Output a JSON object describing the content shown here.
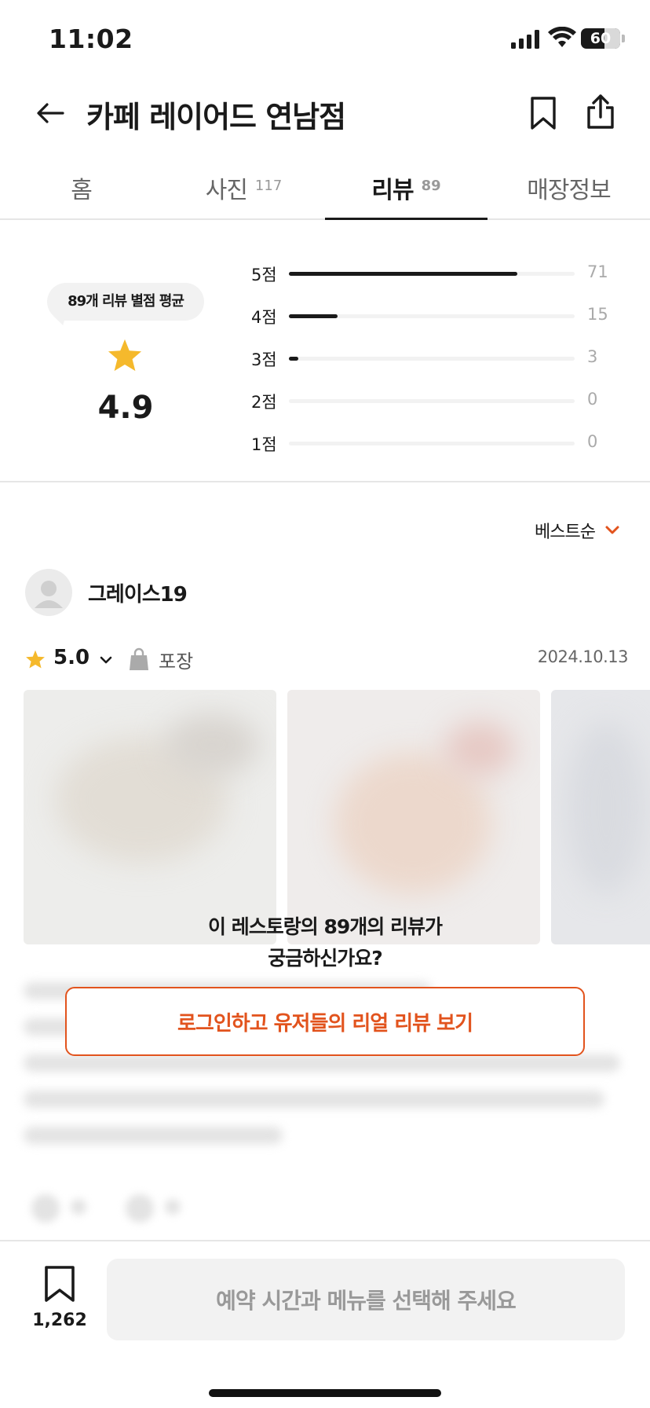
{
  "status_bar": {
    "time": "11:02",
    "battery": "60",
    "battery_fraction": 0.6
  },
  "header": {
    "title": "카페 레이어드 연남점"
  },
  "tabs": [
    {
      "label": "홈",
      "count": ""
    },
    {
      "label": "사진",
      "count": "117"
    },
    {
      "label": "리뷰",
      "count": "89"
    },
    {
      "label": "매장정보",
      "count": ""
    }
  ],
  "active_tab": "리뷰",
  "rating_summary": {
    "bubble_label": "89개 리뷰 별점 평균",
    "average": "4.9",
    "distribution": [
      {
        "label": "5점",
        "count": "71",
        "fraction": 0.8
      },
      {
        "label": "4점",
        "count": "15",
        "fraction": 0.17
      },
      {
        "label": "3점",
        "count": "3",
        "fraction": 0.03
      },
      {
        "label": "2점",
        "count": "0",
        "fraction": 0
      },
      {
        "label": "1점",
        "count": "0",
        "fraction": 0
      }
    ]
  },
  "sort": {
    "label": "베스트순"
  },
  "review": {
    "author": "그레이스19",
    "rating": "5.0",
    "type": "포장",
    "date": "2024.10.13"
  },
  "login_gate": {
    "question_line1": "이 레스토랑의 89개의 리뷰가",
    "question_line2": "궁금하신가요?",
    "button_label": "로그인하고 유저들의 리얼 리뷰 보기"
  },
  "bottom_bar": {
    "save_count": "1,262",
    "reserve_label": "예약 시간과 메뉴를 선택해 주세요"
  },
  "colors": {
    "accent": "#e2531d",
    "star": "#f5b92c",
    "text": "#1a1a1a"
  }
}
